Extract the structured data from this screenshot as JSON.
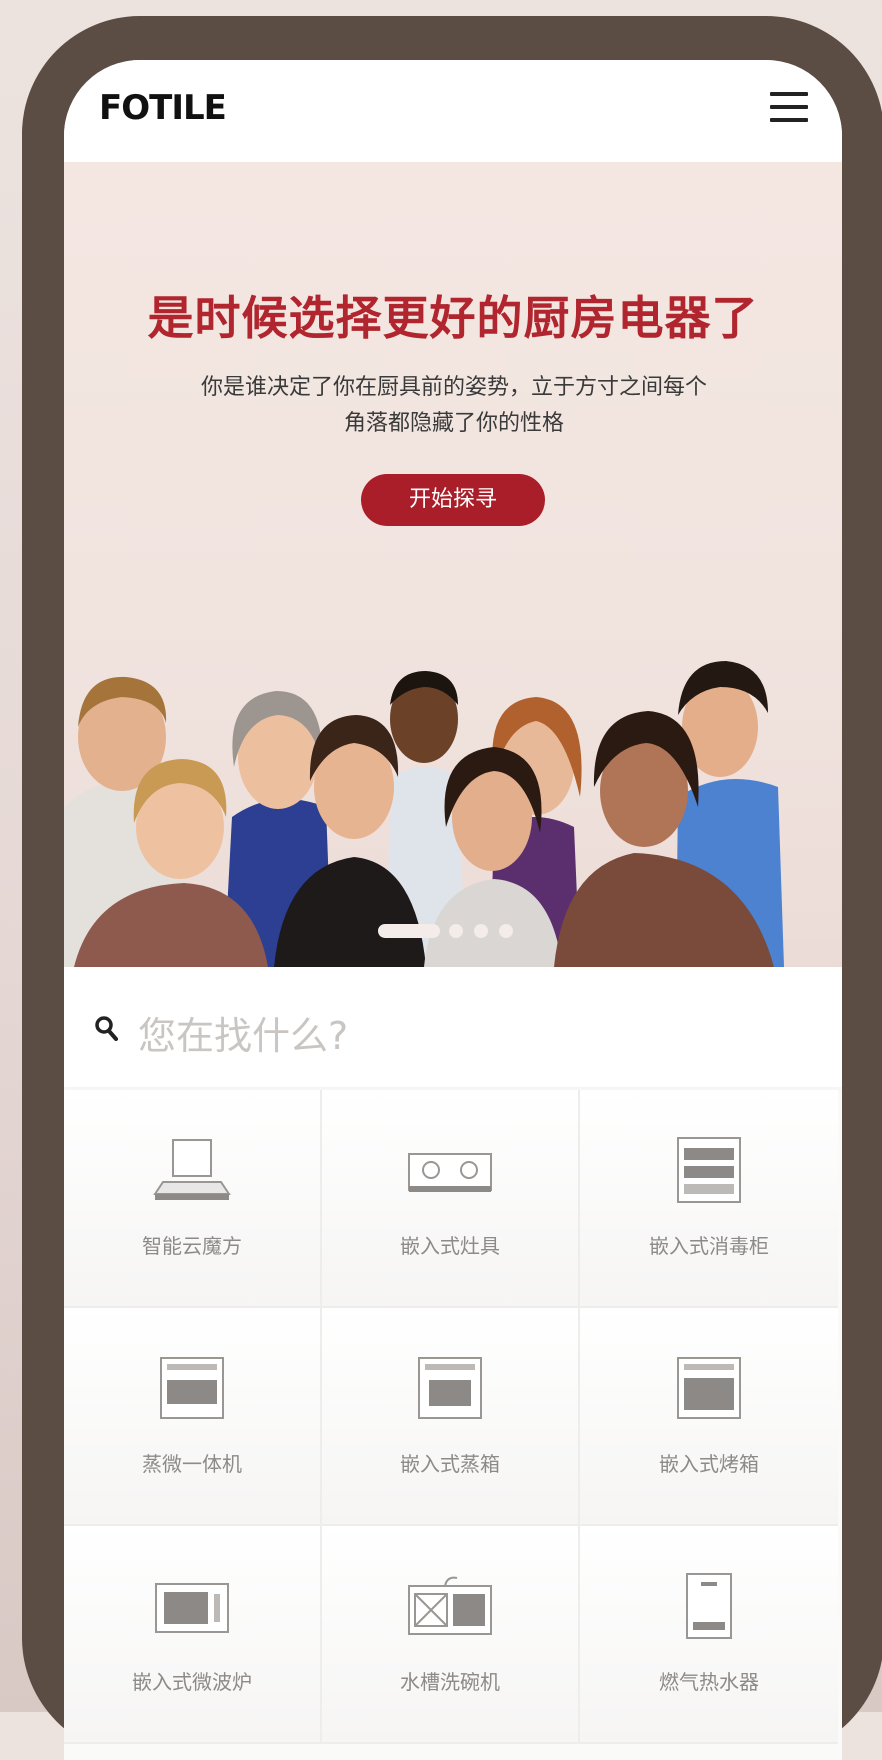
{
  "header": {
    "logo": "FOTILE",
    "menu_icon": "hamburger-menu-icon"
  },
  "hero": {
    "title": "是时候选择更好的厨房电器了",
    "subtitle_line1": "你是谁决定了你在厨具前的姿势，立于方寸之间每个",
    "subtitle_line2": "角落都隐藏了你的性格",
    "button_label": "开始探寻",
    "carousel": {
      "slides": 4,
      "active_index": 0
    },
    "colors": {
      "accent": "#b0252e",
      "button": "#a91e28"
    }
  },
  "search": {
    "placeholder": "您在找什么?",
    "icon": "search-icon"
  },
  "categories": [
    {
      "label": "智能云魔方",
      "icon": "range-hood-icon"
    },
    {
      "label": "嵌入式灶具",
      "icon": "cooktop-icon"
    },
    {
      "label": "嵌入式消毒柜",
      "icon": "disinfection-cabinet-icon"
    },
    {
      "label": "蒸微一体机",
      "icon": "steam-microwave-oven-icon"
    },
    {
      "label": "嵌入式蒸箱",
      "icon": "steam-oven-icon"
    },
    {
      "label": "嵌入式烤箱",
      "icon": "oven-icon"
    },
    {
      "label": "嵌入式微波炉",
      "icon": "microwave-icon"
    },
    {
      "label": "水槽洗碗机",
      "icon": "sink-dishwasher-icon"
    },
    {
      "label": "燃气热水器",
      "icon": "water-heater-icon"
    }
  ]
}
